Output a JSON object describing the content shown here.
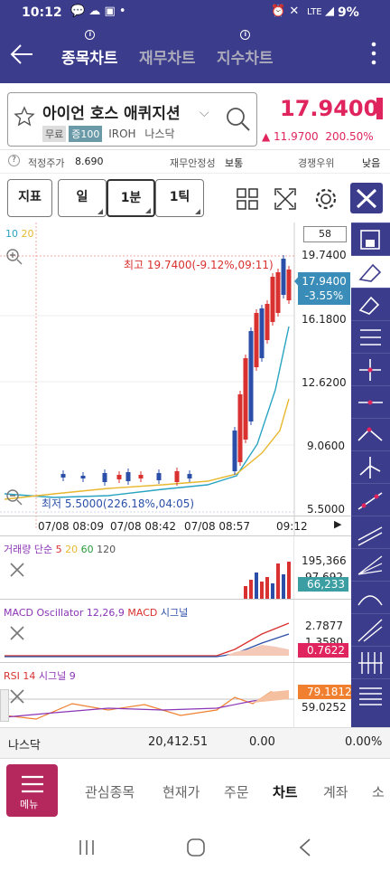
{
  "status_bar": {
    "time": "10:12",
    "battery": "9%",
    "network": "LTE"
  },
  "header": {
    "tabs": [
      {
        "label": "종목차트"
      },
      {
        "label": "재무차트"
      },
      {
        "label": "지수차트"
      }
    ]
  },
  "stock": {
    "name": "아이언 호스 애퀴지션",
    "badges": [
      "무료",
      "증100"
    ],
    "ticker": "IROH",
    "market": "나스닥",
    "price": "17.9400",
    "change": "11.9700",
    "change_pct": "200.50%"
  },
  "metrics": {
    "fair_price_label": "적정주가",
    "fair_price": "8.690",
    "stability_label": "재무안정성",
    "stability": "보통",
    "rank_label": "경쟁우위",
    "rank": "낮음"
  },
  "toolbar": {
    "indicator": "지표",
    "period": "일",
    "interval": "1분",
    "tick": "1틱"
  },
  "chart": {
    "ma_legend": [
      "10",
      "20"
    ],
    "count": "58",
    "high_label": "최고 19.7400(-9.12%,09:11)",
    "low_label": "최저 5.5000(226.18%,04:05)",
    "price_tag": "17.9400",
    "price_tag_pct": "-3.55%",
    "yticks": [
      "19.7400",
      "16.1800",
      "12.6200",
      "9.0600",
      "5.5000"
    ],
    "xticks": [
      "07/08 08:09",
      "07/08 08:42",
      "07/08 08:57",
      "09:12"
    ]
  },
  "volume_panel": {
    "title": "거래량 단순",
    "ma": [
      "5",
      "20",
      "60",
      "120"
    ],
    "values": [
      "195,366",
      "97,692"
    ],
    "current": "66,233"
  },
  "macd_panel": {
    "title": "MACD Oscillator 12,26,9",
    "macd": "MACD",
    "signal": "시그널",
    "values": [
      "2.7877",
      "1.3580"
    ],
    "current": "0.7622"
  },
  "rsi_panel": {
    "title": "RSI 14",
    "signal": "시그널 9",
    "values": [
      "79.1812",
      "59.0252"
    ]
  },
  "index_bar": {
    "name": "나스닥",
    "value": "20,412.51",
    "change": "0.00",
    "change_pct": "0.00%"
  },
  "bottom_nav": {
    "menu": "메뉴",
    "items": [
      "관심종목",
      "현재가",
      "주문",
      "차트",
      "계좌",
      "소"
    ]
  },
  "colors": {
    "header": "#3c3c8c",
    "up": "#e0245e",
    "candle_up": "#d8312f",
    "candle_down": "#2b4fa8",
    "accent_tag": "#3a8db8",
    "macd_tag": "#e0245e",
    "rsi_tag": "#f08030"
  },
  "chart_data": {
    "type": "candlestick",
    "ylim": [
      5.5,
      19.74
    ],
    "yticks": [
      19.74,
      16.18,
      12.62,
      9.06,
      5.5
    ],
    "high": 19.74,
    "low": 5.5,
    "last": 17.94,
    "xticks": [
      "07/08 08:09",
      "07/08 08:42",
      "07/08 08:57",
      "09:12"
    ]
  }
}
